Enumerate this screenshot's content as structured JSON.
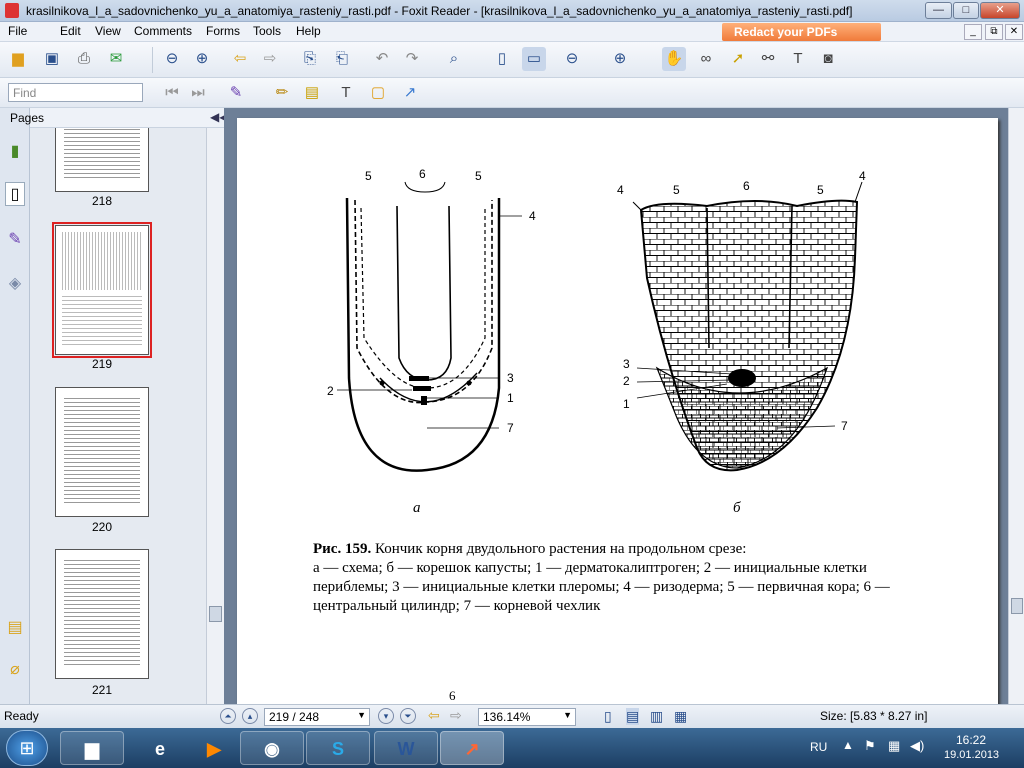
{
  "window": {
    "title": "krasilnikova_l_a_sadovnichenko_yu_a_anatomiya_rasteniy_rasti.pdf - Foxit Reader - [krasilnikova_l_a_sadovnichenko_yu_a_anatomiya_rasteniy_rasti.pdf]",
    "minimize": "—",
    "maximize": "□",
    "close": "✕"
  },
  "menu": [
    "File",
    "Edit",
    "View",
    "Comments",
    "Forms",
    "Tools",
    "Help"
  ],
  "redact_banner": "Redact your PDFs",
  "mdi": [
    "_",
    "⧉",
    "✕"
  ],
  "find": {
    "placeholder": "Find"
  },
  "sidebar": {
    "title": "Pages",
    "collapse": "◀◀",
    "thumbs": [
      {
        "label": "218"
      },
      {
        "label": "219"
      },
      {
        "label": "220"
      },
      {
        "label": "221"
      }
    ]
  },
  "figure": {
    "sub_a": "а",
    "sub_b": "б",
    "labels_a": {
      "top5l": "5",
      "top6": "6",
      "top5r": "5",
      "l4": "4",
      "l3": "3",
      "l2": "2",
      "l1": "1",
      "l7": "7"
    },
    "labels_b": {
      "t4l": "4",
      "t5l": "5",
      "t6": "6",
      "t5r": "5",
      "t4r": "4",
      "l3": "3",
      "l2": "2",
      "l1": "1",
      "l7": "7"
    },
    "caption_bold": "Рис. 159.",
    "caption_rest": " Кончик корня двудольного растения на продольном срезе:",
    "caption_body": "а — схема; б — корешок капусты; 1 — дерматокалиптроген; 2 — инициальные клетки периблемы; 3 — инициальные клетки плеромы; 4 — ризодерма; 5 — первичная кора; 6 — центральный цилиндр; 7 — корневой чехлик",
    "page_number": "6"
  },
  "status": {
    "ready": "Ready",
    "page": "219 / 248",
    "zoom": "136.14%",
    "size": "Size: [5.83 * 8.27 in]"
  },
  "taskbar": {
    "lang": "RU",
    "time": "16:22",
    "date": "19.01.2013"
  }
}
